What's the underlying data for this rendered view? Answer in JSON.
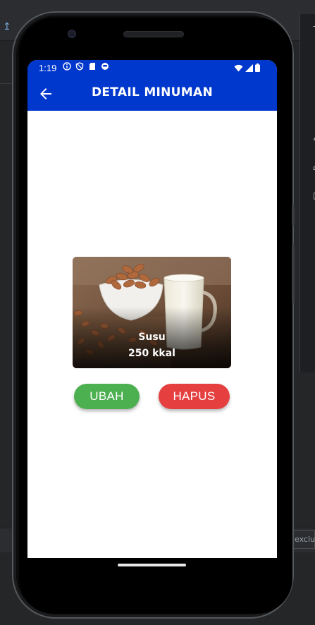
{
  "ide": {
    "exclude_label": "exclu"
  },
  "status_bar": {
    "time": "1:19",
    "icons_left": [
      "info-icon",
      "shield-icon",
      "sd-card-icon",
      "face-icon"
    ],
    "icons_right": [
      "wifi-icon",
      "signal-icon",
      "battery-icon"
    ]
  },
  "app_bar": {
    "back_icon": "arrow-left-icon",
    "title": "DETAIL MINUMAN"
  },
  "drink": {
    "name": "Susu",
    "calories": "250 kkal",
    "image": "almond-milk-photo"
  },
  "actions": {
    "edit_label": "UBAH",
    "delete_label": "HAPUS"
  },
  "colors": {
    "primary": "#0037cc",
    "edit_button": "#4caf50",
    "delete_button": "#e53f3f"
  }
}
